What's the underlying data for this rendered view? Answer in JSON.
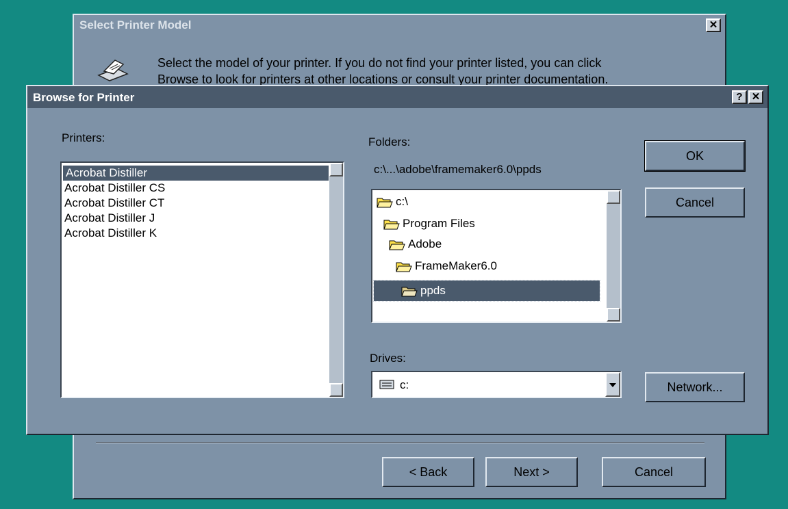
{
  "background_window": {
    "title": "Select Printer Model",
    "close_glyph": "✕",
    "description_line1": "Select the model of your printer. If you do not find your printer listed, you can click",
    "description_line2": "Browse to look for printers at other locations or consult your printer documentation.",
    "buttons": {
      "back": "< Back",
      "next": "Next >",
      "cancel": "Cancel"
    },
    "icon": "printer-icon"
  },
  "dialog": {
    "title": "Browse for Printer",
    "help_glyph": "?",
    "close_glyph": "✕",
    "printers_label": "Printers:",
    "printers": [
      "Acrobat Distiller",
      "Acrobat Distiller CS",
      "Acrobat Distiller CT",
      "Acrobat Distiller J",
      "Acrobat Distiller K"
    ],
    "selected_printer": "Acrobat Distiller",
    "folders_label": "Folders:",
    "current_path": "c:\\...\\adobe\\framemaker6.0\\ppds",
    "folders": [
      "c:\\",
      "Program Files",
      "Adobe",
      "FrameMaker6.0",
      "ppds"
    ],
    "selected_folder": "ppds",
    "drives_label": "Drives:",
    "drive_value": "c:",
    "buttons": {
      "ok": "OK",
      "cancel": "Cancel",
      "network": "Network..."
    },
    "colors": {
      "face": "#7e92a7",
      "title_text": "#ffffff",
      "selection": "#4a5a6c",
      "desktop": "#138a82"
    }
  }
}
